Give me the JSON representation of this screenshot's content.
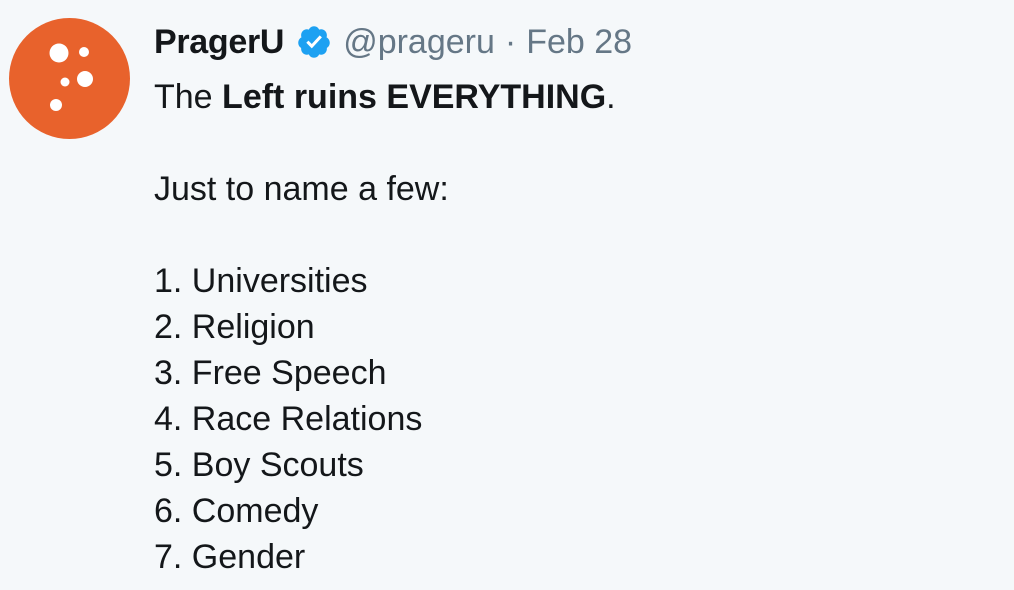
{
  "account": {
    "display_name": "PragerU",
    "handle": "@prageru",
    "separator": "·",
    "date": "Feb 28",
    "verified": true,
    "avatar_icon": "prageru-logo-icon",
    "avatar_color": "#e8622c"
  },
  "tweet": {
    "line1_pre": "The ",
    "line1_bold": "Left ruins EVERYTHING",
    "line1_post": ".",
    "intro": "Just to name a few:",
    "items": [
      "1. Universities",
      "2. Religion",
      "3. Free Speech",
      "4. Race Relations",
      "5. Boy Scouts",
      "6. Comedy",
      "7. Gender"
    ]
  },
  "colors": {
    "background": "#f5f8fa",
    "text": "#14171a",
    "muted": "#657786",
    "verified_badge": "#1da1f2"
  }
}
